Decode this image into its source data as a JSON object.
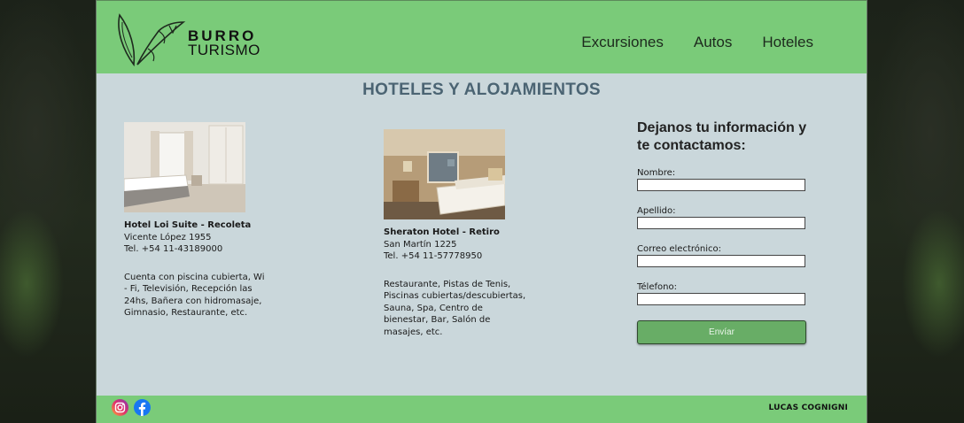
{
  "brand": {
    "line1": "BURRO",
    "line2": "TURISMO"
  },
  "nav": [
    {
      "label": "Excursiones"
    },
    {
      "label": "Autos"
    },
    {
      "label": "Hoteles"
    }
  ],
  "page_title": "HOTELES Y ALOJAMIENTOS",
  "hotels": [
    {
      "name": "Hotel Loi Suite - Recoleta",
      "address": "Vicente López 1955",
      "phone": "Tel. +54 11-43189000",
      "description": "Cuenta con piscina cubierta, Wi - Fi, Televisión, Recepción las 24hs, Bañera con hidromasaje, Gimnasio, Restaurante, etc."
    },
    {
      "name": "Sheraton Hotel - Retiro",
      "address": "San Martín 1225",
      "phone": "Tel. +54 11-57778950",
      "description": "Restaurante, Pistas de Tenis, Piscinas cubiertas/descubiertas, Sauna, Spa, Centro de bienestar, Bar, Salón de masajes, etc."
    }
  ],
  "form": {
    "heading": "Dejanos tu información y te contactamos:",
    "fields": [
      {
        "label": "Nombre:",
        "value": ""
      },
      {
        "label": "Apellido:",
        "value": ""
      },
      {
        "label": "Correo electrónico:",
        "value": ""
      },
      {
        "label": "Télefono:",
        "value": ""
      }
    ],
    "submit_label": "Envíar"
  },
  "footer": {
    "social": [
      {
        "icon": "instagram-icon"
      },
      {
        "icon": "facebook-icon"
      }
    ],
    "author": "LUCAS COGNIGNI"
  },
  "colors": {
    "header_green": "#7acb79",
    "page_bg": "#cad7db",
    "title_color": "#4b6473",
    "button_green": "#68ad66"
  }
}
